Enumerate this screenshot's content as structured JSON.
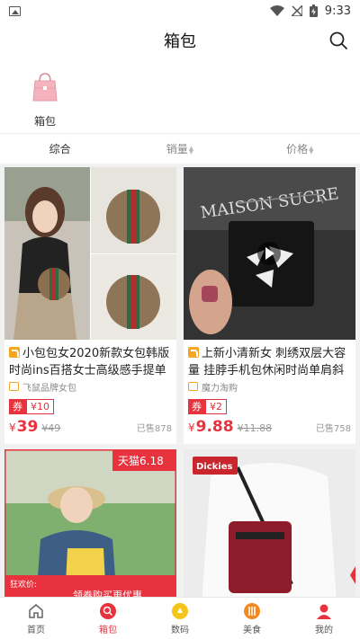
{
  "status_bar": {
    "time": "9:33"
  },
  "header": {
    "title": "箱包"
  },
  "category": {
    "label": "箱包"
  },
  "sort_tabs": [
    "综合",
    "销量",
    "价格"
  ],
  "products": [
    {
      "title": "小包包女2020新款女包韩版时尚ins百搭女士高级感手提单肩斜挎包",
      "shop": "飞鼠品牌女包",
      "coupon_prefix": "券",
      "coupon_value": "¥10",
      "currency": "¥",
      "price": "39",
      "original_price": "¥49",
      "sold": "已售878"
    },
    {
      "title": "上新小清新女 刺绣双层大容量 挂脖手机包休闲时尚单肩斜挎包",
      "shop": "魔力淘购",
      "coupon_prefix": "券",
      "coupon_value": "¥2",
      "currency": "¥",
      "price": "9.88",
      "original_price": "¥11.88",
      "sold": "已售758"
    }
  ],
  "product_images": {
    "store_badge": "天猫6.18",
    "promo_label": "狂欢价:",
    "promo_banner": "领券购买更优惠",
    "brand_logo": "Dickies",
    "poster_text": "MAISON SUCRE"
  },
  "bottom_nav": [
    {
      "label": "首页",
      "icon": "home-icon"
    },
    {
      "label": "箱包",
      "icon": "search-icon"
    },
    {
      "label": "数码",
      "icon": "digital-icon"
    },
    {
      "label": "美食",
      "icon": "food-icon"
    },
    {
      "label": "我的",
      "icon": "person-icon"
    }
  ],
  "colors": {
    "accent": "#e8323e",
    "coupon": "#e8323e",
    "tmall_badge": "#f5a623"
  }
}
